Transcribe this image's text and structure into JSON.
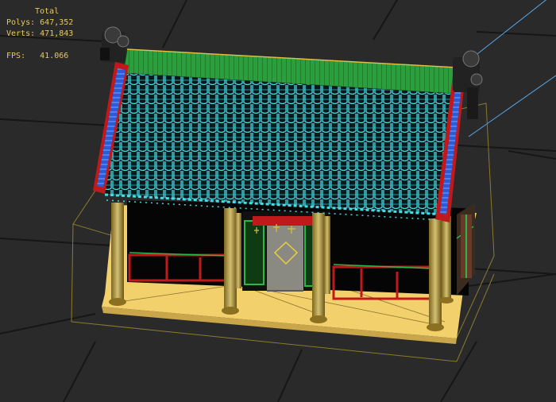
{
  "viewport": {
    "stats": {
      "title": "Total",
      "polys_label": "Polys:",
      "polys_value": "647,352",
      "verts_label": "Verts:",
      "verts_value": "471,843",
      "fps_label": "FPS:",
      "fps_value": "41.066"
    },
    "scene_object": "chinese-pavilion-model",
    "colors": {
      "background": "#2a2a2a",
      "grid": "#1a1a1a",
      "stats_text": "#e8c860",
      "roof_tiles": "#40d8e0",
      "ridge": "#2c9c3c",
      "eave_red": "#c0191c",
      "eave_blue": "#2c5cd8",
      "columns": "#a8923c",
      "platform": "#f0d070",
      "wall_black": "#000000",
      "door": "#8a8a82",
      "bbox": "#8a7a30",
      "camera_line": "#5aa8e8"
    }
  }
}
